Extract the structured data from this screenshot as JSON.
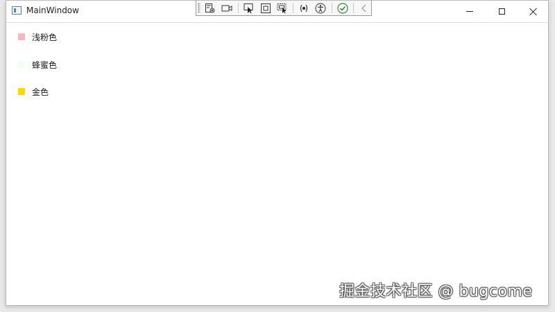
{
  "window": {
    "title": "MainWindow"
  },
  "title_controls": [
    "minimize-icon",
    "maximize-icon",
    "close-icon"
  ],
  "dev_toolbar": {
    "tools": [
      "live-visual-tree-icon",
      "record-video-icon",
      "select-element-icon",
      "display-layout-adorners-icon",
      "track-focused-element-icon",
      "binding-failures-icon",
      "accessibility-checker-icon",
      "hot-reload-ok-icon",
      "collapse-chevron-icon"
    ]
  },
  "colors": [
    {
      "label": "浅粉色",
      "swatch": "#FFB6C1"
    },
    {
      "label": "蜂蜜色",
      "swatch": "#F0FFF0"
    },
    {
      "label": "金色",
      "swatch": "#FFD700"
    }
  ],
  "watermark": "掘金技术社区 @ bugcome"
}
